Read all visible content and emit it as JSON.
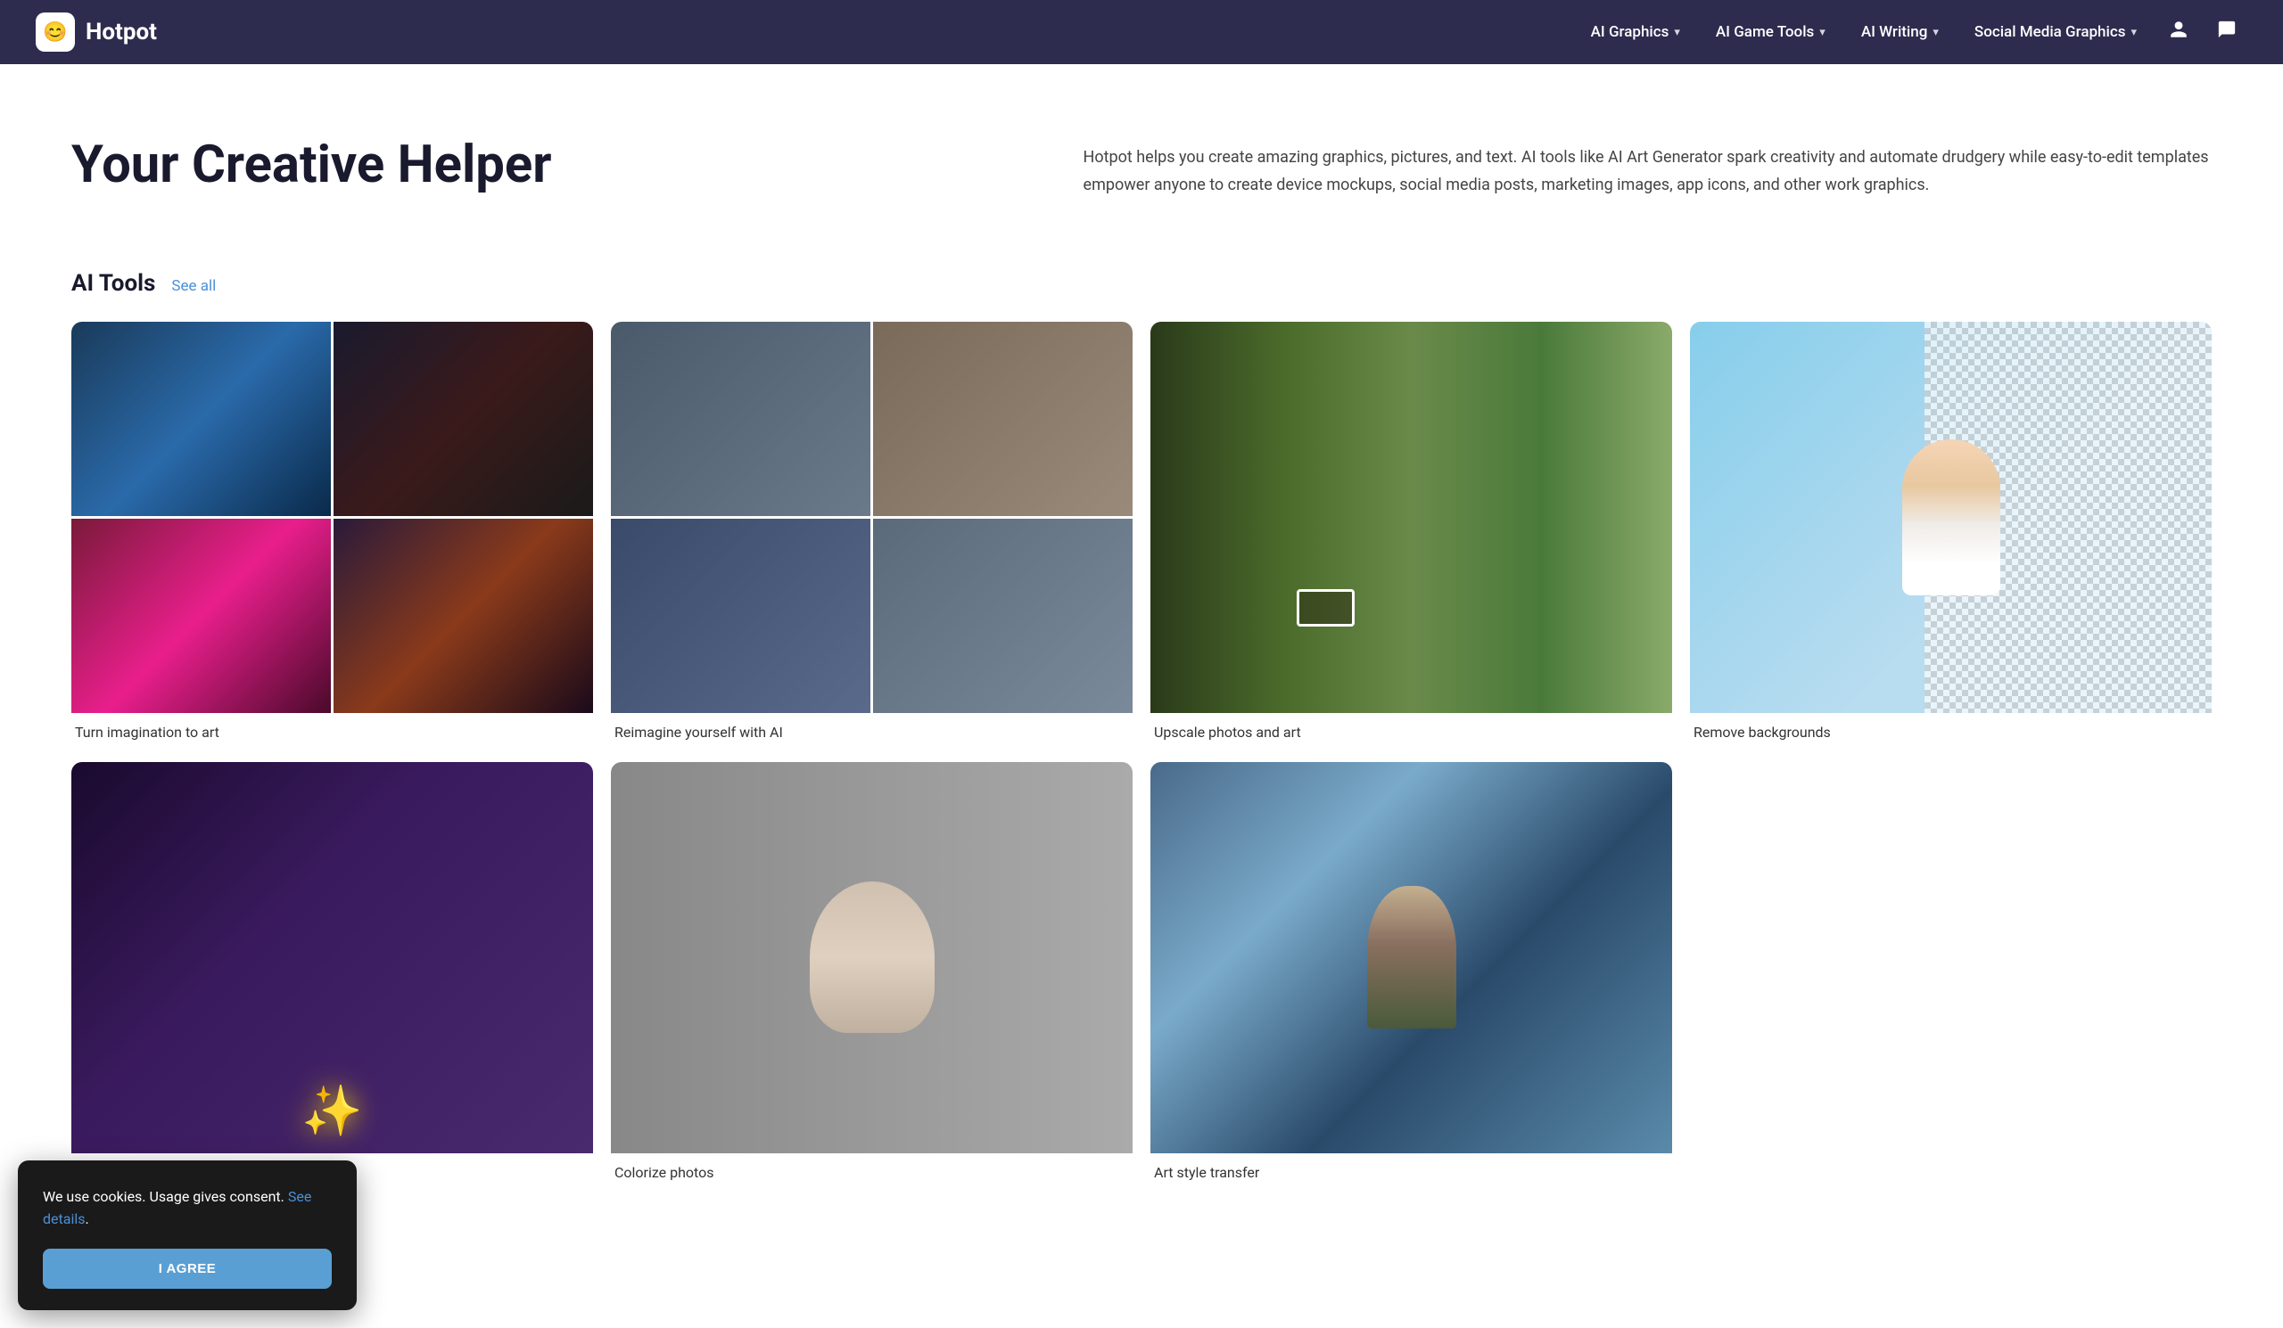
{
  "logo": {
    "icon": "😊",
    "text": "Hotpot"
  },
  "nav": {
    "items": [
      {
        "label": "AI Graphics",
        "hasDropdown": true
      },
      {
        "label": "AI Game Tools",
        "hasDropdown": true
      },
      {
        "label": "AI Writing",
        "hasDropdown": true
      },
      {
        "label": "Social Media Graphics",
        "hasDropdown": true
      }
    ]
  },
  "hero": {
    "title": "Your Creative Helper",
    "description": "Hotpot helps you create amazing graphics, pictures, and text. AI tools like AI Art Generator spark creativity and automate drudgery while easy-to-edit templates empower anyone to create device mockups, social media posts, marketing images, app icons, and other work graphics."
  },
  "aiTools": {
    "sectionTitle": "AI Tools",
    "seeAllLabel": "See all",
    "cards": [
      {
        "label": "Turn imagination to art",
        "type": "ai-art"
      },
      {
        "label": "Reimagine yourself with AI",
        "type": "reimagine"
      },
      {
        "label": "Upscale photos and art",
        "type": "upscale"
      },
      {
        "label": "Remove backgrounds",
        "type": "bg-remove"
      }
    ],
    "cards2": [
      {
        "label": "AI Sparkle",
        "type": "sparkle"
      },
      {
        "label": "Colorize photos",
        "type": "colorize"
      },
      {
        "label": "Art style transfer",
        "type": "mona"
      }
    ]
  },
  "cookie": {
    "message": "We use cookies. Usage gives consent.",
    "linkText": "See details",
    "buttonLabel": "I AGREE"
  }
}
